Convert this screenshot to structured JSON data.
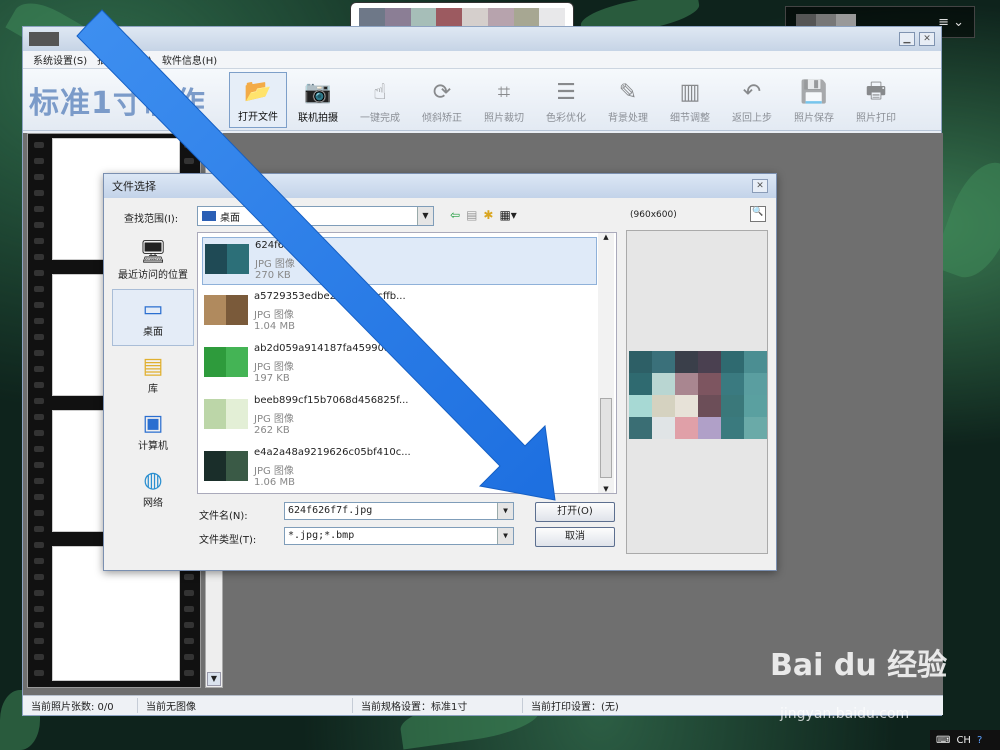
{
  "app": {
    "menu": [
      "系统设置(S)",
      "批量处理(B)",
      "软件信息(H)"
    ],
    "title": "标准1寸制作",
    "tools": [
      {
        "label": "打开文件",
        "icon": "folder-icon",
        "enabled": true,
        "active": true
      },
      {
        "label": "联机拍摄",
        "icon": "camera-icon",
        "enabled": true,
        "active": false
      },
      {
        "label": "一键完成",
        "icon": "hand-icon",
        "enabled": false,
        "active": false
      },
      {
        "label": "倾斜矫正",
        "icon": "rotate-icon",
        "enabled": false,
        "active": false
      },
      {
        "label": "照片裁切",
        "icon": "crop-icon",
        "enabled": false,
        "active": false
      },
      {
        "label": "色彩优化",
        "icon": "sliders-icon",
        "enabled": false,
        "active": false
      },
      {
        "label": "背景处理",
        "icon": "brush-icon",
        "enabled": false,
        "active": false
      },
      {
        "label": "细节调整",
        "icon": "histogram-icon",
        "enabled": false,
        "active": false
      },
      {
        "label": "返回上步",
        "icon": "undo-icon",
        "enabled": false,
        "active": false
      },
      {
        "label": "照片保存",
        "icon": "save-icon",
        "enabled": false,
        "active": false
      },
      {
        "label": "照片打印",
        "icon": "printer-icon",
        "enabled": false,
        "active": false
      }
    ],
    "status": [
      "当前照片张数: 0/0",
      "当前无图像",
      "当前规格设置：标准1寸",
      "当前打印设置：(无)"
    ]
  },
  "dialog": {
    "title": "文件选择",
    "lookin_label": "查找范围(I):",
    "lookin_value": "桌面",
    "places": [
      "最近访问的位置",
      "桌面",
      "库",
      "计算机",
      "网络"
    ],
    "files": [
      {
        "name": "624f626f7f.jpg",
        "type": "JPG 图像",
        "size": "270 KB",
        "colors": [
          "#1f4a55",
          "#2c6f78"
        ]
      },
      {
        "name": "a5729353edbe2694...35cffb...",
        "type": "JPG 图像",
        "size": "1.04 MB",
        "colors": [
          "#b08a5e",
          "#7a5a3a"
        ]
      },
      {
        "name": "ab2d059a914187fa45990a88...",
        "type": "JPG 图像",
        "size": "197 KB",
        "colors": [
          "#2e9b3c",
          "#44b455"
        ]
      },
      {
        "name": "beeb899cf15b7068d456825f...",
        "type": "JPG 图像",
        "size": "262 KB",
        "colors": [
          "#bcd6a8",
          "#e3efd6"
        ]
      },
      {
        "name": "e4a2a48a9219626c05bf410c...",
        "type": "JPG 图像",
        "size": "1.06 MB",
        "colors": [
          "#1a2e2a",
          "#3a5a46"
        ]
      }
    ],
    "filename_label": "文件名(N):",
    "filename_value": "624f626f7f.jpg",
    "filetype_label": "文件类型(T):",
    "filetype_value": "*.jpg;*.bmp",
    "open_label": "打开(O)",
    "cancel_label": "取消",
    "preview_size": "(960x600)"
  },
  "watermark": {
    "text": "Bai du 经验",
    "url": "jingyan.baidu.com"
  },
  "tray": {
    "lang": "CH"
  }
}
